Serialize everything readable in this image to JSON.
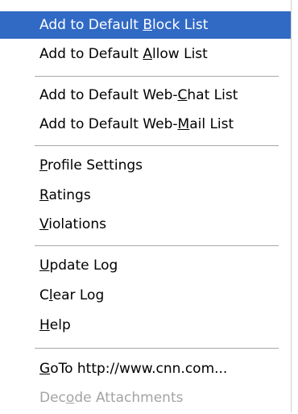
{
  "colors": {
    "highlight_background": "#316ac5",
    "highlight_text": "#ffffff",
    "text": "#000000",
    "disabled_text": "#a3a3a3",
    "separator": "#a7a6aa"
  },
  "menu": {
    "groups": [
      {
        "items": [
          {
            "name": "add-to-default-block-list",
            "pre": "Add to Default ",
            "key": "B",
            "post": "lock List",
            "state": "highlighted"
          },
          {
            "name": "add-to-default-allow-list",
            "pre": "Add to Default ",
            "key": "A",
            "post": "llow List",
            "state": "normal"
          }
        ]
      },
      {
        "items": [
          {
            "name": "add-to-default-web-chat-list",
            "pre": "Add to Default Web-",
            "key": "C",
            "post": "hat List",
            "state": "normal"
          },
          {
            "name": "add-to-default-web-mail-list",
            "pre": "Add to Default Web-",
            "key": "M",
            "post": "ail List",
            "state": "normal"
          }
        ]
      },
      {
        "items": [
          {
            "name": "profile-settings",
            "pre": "",
            "key": "P",
            "post": "rofile Settings",
            "state": "normal"
          },
          {
            "name": "ratings",
            "pre": "",
            "key": "R",
            "post": "atings",
            "state": "normal"
          },
          {
            "name": "violations",
            "pre": "",
            "key": "V",
            "post": "iolations",
            "state": "normal"
          }
        ]
      },
      {
        "items": [
          {
            "name": "update-log",
            "pre": "",
            "key": "U",
            "post": "pdate Log",
            "state": "normal"
          },
          {
            "name": "clear-log",
            "pre": "C",
            "key": "l",
            "post": "ear Log",
            "state": "normal"
          },
          {
            "name": "help",
            "pre": "",
            "key": "H",
            "post": "elp",
            "state": "normal"
          }
        ]
      },
      {
        "items": [
          {
            "name": "goto-url",
            "pre": "",
            "key": "G",
            "post": "oTo http://www.cnn.com...",
            "state": "normal"
          },
          {
            "name": "decode-attachments",
            "pre": "Dec",
            "key": "o",
            "post": "de Attachments",
            "state": "disabled"
          }
        ]
      }
    ]
  }
}
